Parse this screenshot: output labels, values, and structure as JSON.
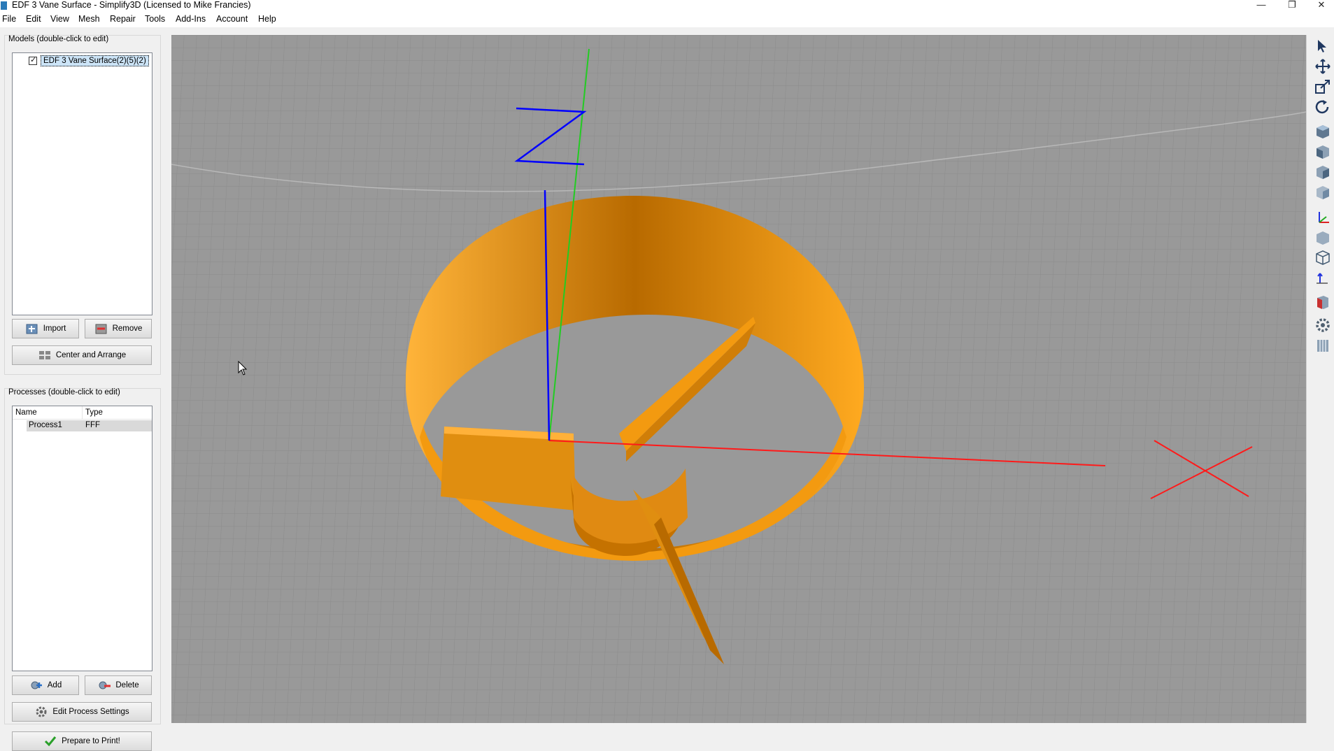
{
  "window": {
    "title": "EDF 3 Vane Surface - Simplify3D (Licensed to Mike Francies)",
    "controls": {
      "minimize": "—",
      "restore": "❐",
      "close": "✕"
    }
  },
  "menu": [
    "File",
    "Edit",
    "View",
    "Mesh",
    "Repair",
    "Tools",
    "Add-Ins",
    "Account",
    "Help"
  ],
  "models": {
    "group_label": "Models (double-click to edit)",
    "items": [
      {
        "name": "EDF 3 Vane Surface(2)(5)(2)",
        "checked": true
      }
    ],
    "import_label": "Import",
    "remove_label": "Remove",
    "center_label": "Center and Arrange"
  },
  "processes": {
    "group_label": "Processes (double-click to edit)",
    "columns": [
      "Name",
      "Type"
    ],
    "rows": [
      {
        "name": "Process1",
        "type": "FFF"
      }
    ],
    "add_label": "Add",
    "delete_label": "Delete",
    "edit_label": "Edit Process Settings",
    "prepare_label": "Prepare to Print!"
  },
  "viewport": {
    "axis_label": "Z",
    "colors": {
      "model": "#f39a10",
      "x_axis": "#ff1a1a",
      "y_axis": "#22cc22",
      "z_axis": "#0000ff",
      "background": "#999999",
      "grid": "#8a8a8a"
    }
  },
  "right_toolbar": [
    "select-icon",
    "move-icon",
    "scale-icon",
    "rotate-icon",
    "view-top-icon",
    "view-front-icon",
    "view-side-icon",
    "view-iso-icon",
    "axes-icon",
    "solid-icon",
    "wireframe-icon",
    "cross-section-icon",
    "supports-icon",
    "settings-icon",
    "layers-icon"
  ]
}
